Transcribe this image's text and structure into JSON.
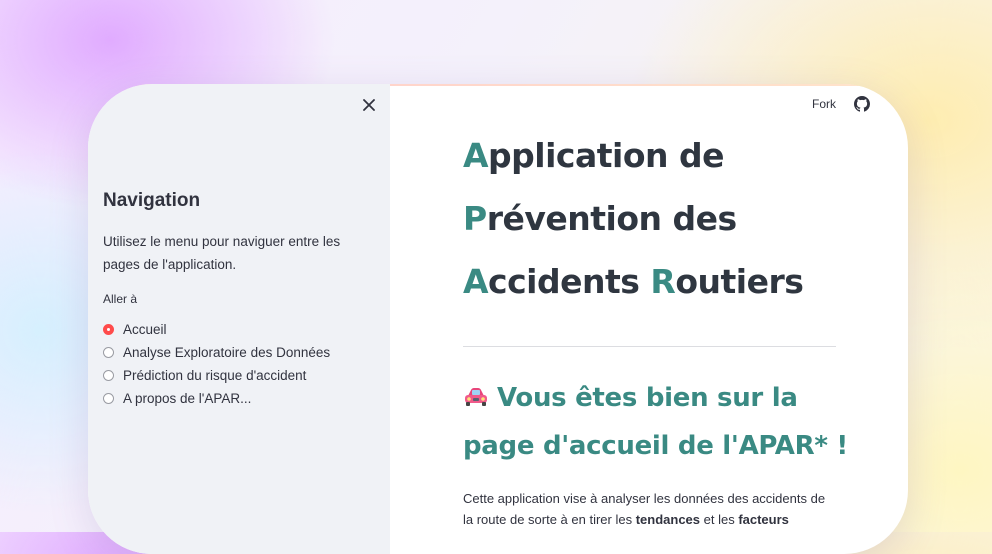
{
  "header": {
    "fork_label": "Fork",
    "github_icon": "github-icon",
    "close_icon": "close-icon"
  },
  "sidebar": {
    "title": "Navigation",
    "description_line1": "Utilisez le menu pour naviguer entre les",
    "description_line2": "pages de l'application.",
    "radio_label": "Aller à",
    "options": [
      {
        "label": "Accueil",
        "selected": true
      },
      {
        "label": "Analyse Exploratoire des Données",
        "selected": false
      },
      {
        "label": "Prédiction du risque d'accident",
        "selected": false
      },
      {
        "label": "A propos de l'APAR...",
        "selected": false
      }
    ]
  },
  "main": {
    "title": {
      "line1_initial": "A",
      "line1_rest": "pplication de",
      "line2_initial": "P",
      "line2_rest": "révention des",
      "line3_initial": "A",
      "line3_mid": "ccidents ",
      "line3_initial2": "R",
      "line3_rest": "outiers"
    },
    "welcome_line1": "Vous êtes bien sur la",
    "welcome_line2": "page d'accueil de l'APAR* !",
    "welcome_icon": "car-icon",
    "intro": {
      "line1": "Cette application vise à analyser les données des accidents de",
      "line2_start": "la route de sorte à en tirer les ",
      "bold1": "tendances",
      "line2_mid": " et les ",
      "bold2": "facteurs"
    }
  },
  "colors": {
    "accent": "#3a8a83",
    "selected_radio": "#ff4b4b",
    "sidebar_bg": "#f0f2f6",
    "text": "#31333f"
  }
}
